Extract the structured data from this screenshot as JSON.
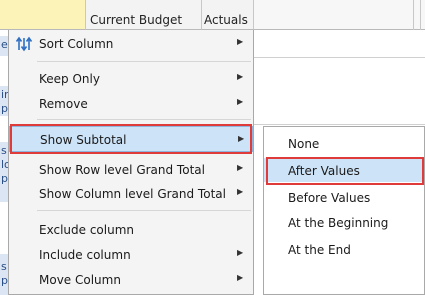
{
  "grid": {
    "headers": {
      "budget": "Current Budget",
      "actuals": "Actuals"
    },
    "left_chars": [
      "e",
      "in",
      "pe",
      "s",
      "lo",
      "pe",
      "s",
      "pe"
    ]
  },
  "context_menu": {
    "items": [
      {
        "label": "Sort Column",
        "icon": "sort-columns-icon",
        "has_submenu": true
      },
      {
        "label": "Keep Only",
        "has_submenu": true
      },
      {
        "label": "Remove",
        "has_submenu": true
      },
      {
        "label": "Show Subtotal",
        "has_submenu": true,
        "selected": true
      },
      {
        "label": "Show Row level Grand Total",
        "has_submenu": true
      },
      {
        "label": "Show Column level Grand Total",
        "has_submenu": true
      },
      {
        "label": "Exclude column",
        "has_submenu": false
      },
      {
        "label": "Include column",
        "has_submenu": true
      },
      {
        "label": "Move Column",
        "has_submenu": true
      }
    ]
  },
  "submenu": {
    "items": [
      {
        "label": "None"
      },
      {
        "label": "After Values",
        "selected": true
      },
      {
        "label": "Before Values"
      },
      {
        "label": "At the Beginning"
      },
      {
        "label": "At the End"
      }
    ]
  },
  "colors": {
    "highlight_border": "#e03b3b",
    "selected_fill": "#cde3f7",
    "header_yellow": "#fbf3b8"
  }
}
